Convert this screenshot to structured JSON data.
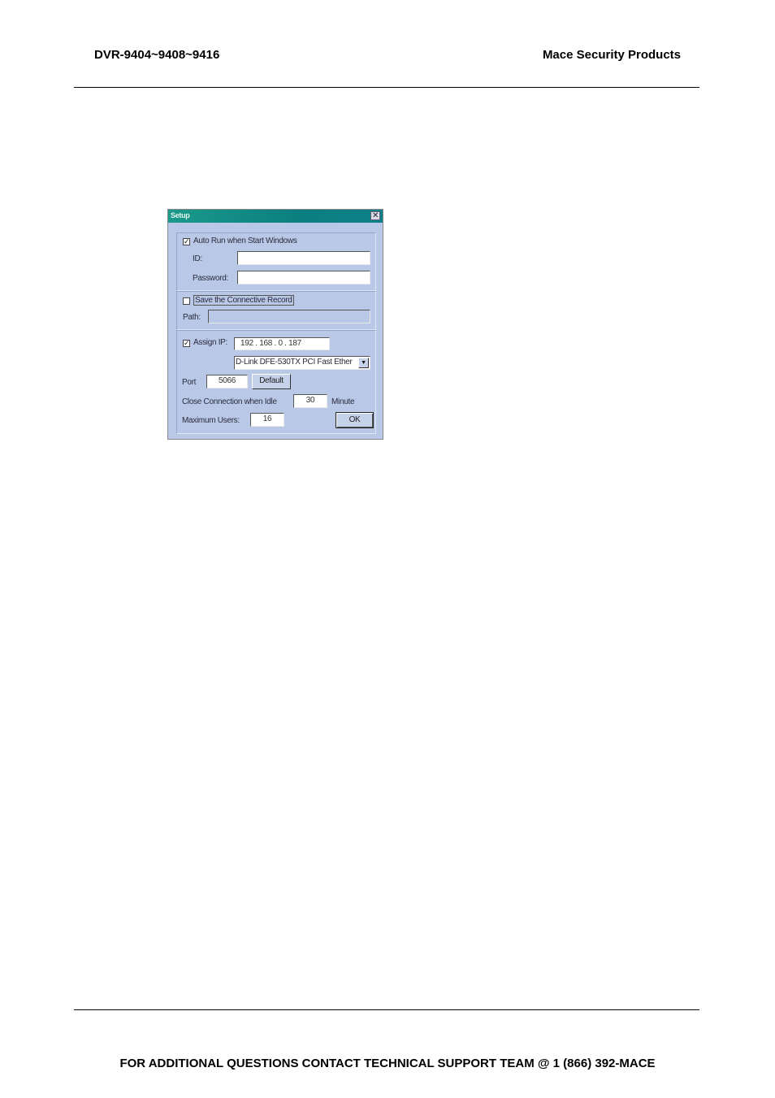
{
  "header": {
    "left": "DVR-9404~9408~9416",
    "right": "Mace Security Products"
  },
  "footer": {
    "text": "FOR ADDITIONAL QUESTIONS CONTACT TECHNICAL SUPPORT TEAM @ 1 (866) 392-MACE"
  },
  "dialog": {
    "title": "Setup",
    "close_glyph": "✕",
    "auto_run": {
      "label": "Auto Run when Start Windows",
      "checked": true,
      "check_glyph": "✓"
    },
    "id": {
      "label": "ID:",
      "value": ""
    },
    "password": {
      "label": "Password:",
      "value": ""
    },
    "save_record": {
      "label": "Save the Connective Record",
      "checked": false
    },
    "path": {
      "label": "Path:",
      "value": ""
    },
    "assign_ip": {
      "label": "Assign IP:",
      "checked": true,
      "check_glyph": "✓",
      "value": "192 . 168 .  0  . 187"
    },
    "adapter": {
      "selected": "D-Link DFE-530TX PCI Fast Ether",
      "arrow_glyph": "▼"
    },
    "port": {
      "label": "Port",
      "value": "5066"
    },
    "default_button": {
      "label": "Default"
    },
    "idle": {
      "label": "Close Connection when Idle",
      "value": "30",
      "unit": "Minute"
    },
    "max_users": {
      "label": "Maximum Users:",
      "value": "16"
    },
    "ok_button": {
      "label": "OK"
    }
  }
}
